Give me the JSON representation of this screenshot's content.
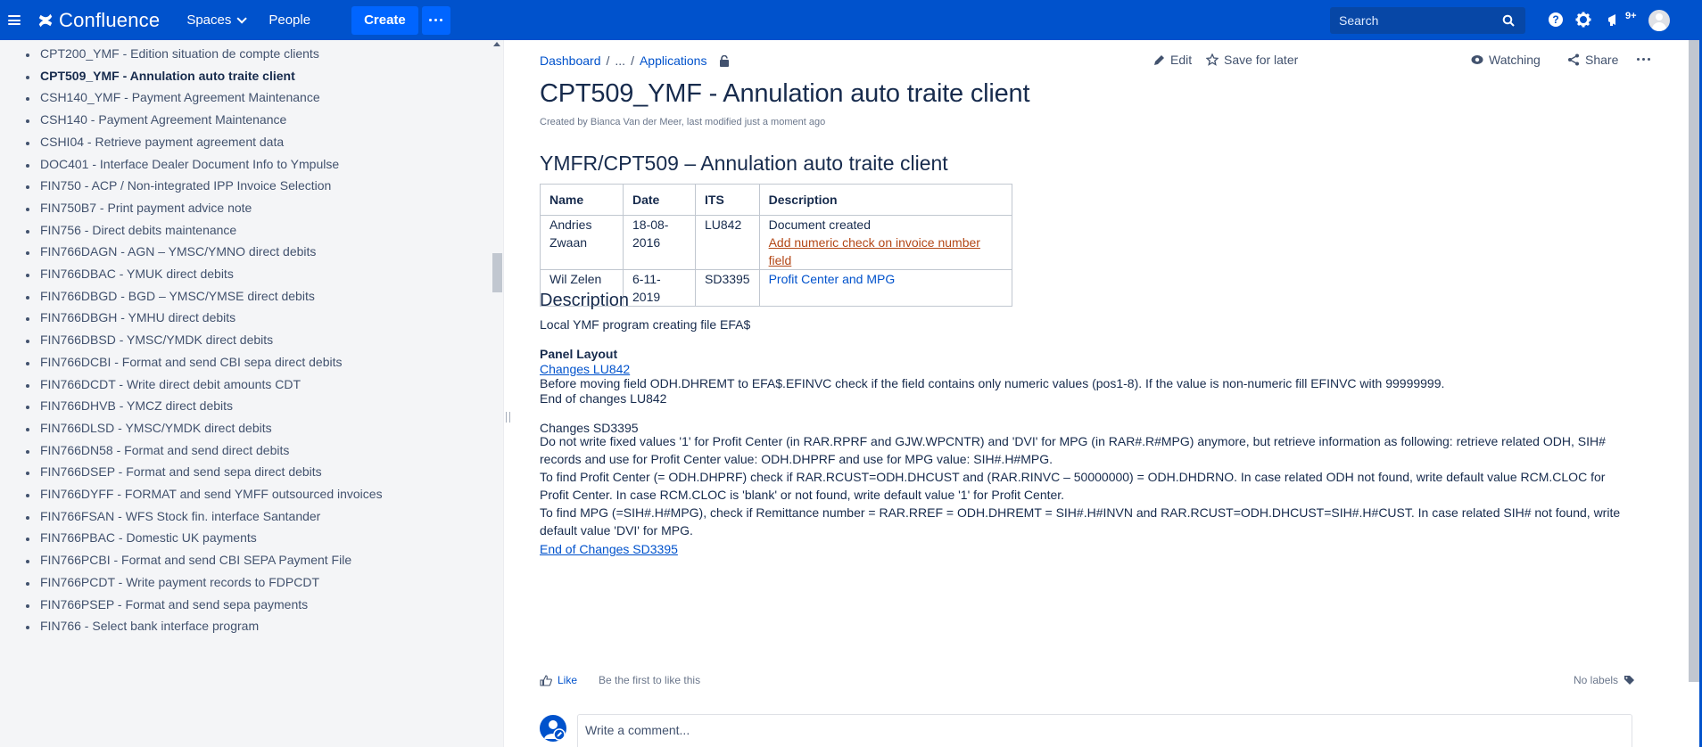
{
  "app": {
    "logo_text": "Confluence",
    "nav": {
      "spaces": "Spaces",
      "people": "People",
      "create": "Create"
    },
    "search_placeholder": "Search",
    "notifications_badge": "9+",
    "brand_color": "#0052cc"
  },
  "sidebar": {
    "items": [
      {
        "label": "CPT200_YMF - Edition situation de compte clients",
        "active": false
      },
      {
        "label": "CPT509_YMF - Annulation auto traite client",
        "active": true
      },
      {
        "label": "CSH140_YMF - Payment Agreement Maintenance",
        "active": false
      },
      {
        "label": "CSH140 - Payment Agreement Maintenance",
        "active": false
      },
      {
        "label": "CSHI04 - Retrieve payment agreement data",
        "active": false
      },
      {
        "label": "DOC401 - Interface Dealer Document Info to Ympulse",
        "active": false
      },
      {
        "label": "FIN750 - ACP / Non-integrated IPP Invoice Selection",
        "active": false
      },
      {
        "label": "FIN750B7 - Print payment advice note",
        "active": false
      },
      {
        "label": "FIN756 - Direct debits maintenance",
        "active": false
      },
      {
        "label": "FIN766DAGN - AGN – YMSC/YMNO direct debits",
        "active": false
      },
      {
        "label": "FIN766DBAC - YMUK direct debits",
        "active": false
      },
      {
        "label": "FIN766DBGD - BGD – YMSC/YMSE direct debits",
        "active": false
      },
      {
        "label": "FIN766DBGH - YMHU direct debits",
        "active": false
      },
      {
        "label": "FIN766DBSD - YMSC/YMDK direct debits",
        "active": false
      },
      {
        "label": "FIN766DCBI - Format and send CBI sepa direct debits",
        "active": false
      },
      {
        "label": "FIN766DCDT - Write direct debit amounts CDT",
        "active": false
      },
      {
        "label": "FIN766DHVB - YMCZ direct debits",
        "active": false
      },
      {
        "label": "FIN766DLSD - YMSC/YMDK direct debits",
        "active": false
      },
      {
        "label": "FIN766DN58 - Format and send direct debits",
        "active": false
      },
      {
        "label": "FIN766DSEP - Format and send sepa direct debits",
        "active": false
      },
      {
        "label": "FIN766DYFF - FORMAT and send YMFF outsourced invoices",
        "active": false
      },
      {
        "label": "FIN766FSAN - WFS Stock fin. interface Santander",
        "active": false
      },
      {
        "label": "FIN766PBAC - Domestic UK payments",
        "active": false
      },
      {
        "label": "FIN766PCBI - Format and send CBI SEPA Payment File",
        "active": false
      },
      {
        "label": "FIN766PCDT - Write payment records to FDPCDT",
        "active": false
      },
      {
        "label": "FIN766PSEP - Format and send sepa payments",
        "active": false
      },
      {
        "label": "FIN766 - Select bank interface program",
        "active": false
      }
    ]
  },
  "breadcrumb": {
    "dashboard": "Dashboard",
    "sep1": "/",
    "ellipsis": "...",
    "sep2": "/",
    "applications": "Applications"
  },
  "actions": {
    "edit": "Edit",
    "save": "Save for later",
    "watching": "Watching",
    "share": "Share"
  },
  "page": {
    "title": "CPT509_YMF - Annulation auto traite client",
    "byline": "Created by Bianca Van der Meer, last modified just a moment ago",
    "heading": "YMFR/CPT509 – Annulation auto traite client",
    "table": {
      "headers": [
        "Name",
        "Date",
        "ITS",
        "Description"
      ],
      "rows": [
        {
          "name": "Andries Zwaan",
          "date": "18-08-2016",
          "its": "LU842",
          "desc1": "Document created",
          "desc2": "Add numeric check on invoice number field"
        },
        {
          "name": "Wil Zelen",
          "date": "6-11-2019",
          "its": "SD3395",
          "desc1": "Profit Center and MPG"
        }
      ]
    },
    "description_heading": "Description",
    "description_text": "Local YMF program creating file EFA$",
    "panel_layout": "Panel Layout",
    "changes_lu842": "Changes LU842",
    "lu842_text": "Before moving field ODH.DHREMT to EFA$.EFINVC check if the field contains only numeric values (pos1-8). If the value is non-numeric fill EFINVC with 99999999.",
    "end_lu842": "End of changes LU842",
    "changes_sd3395": "Changes SD3395",
    "sd3395_p1": "Do not write fixed values '1' for Profit Center (in RAR.RPRF and GJW.WPCNTR) and 'DVI' for MPG (in RAR#.R#MPG) anymore, but retrieve information as following: retrieve related ODH, SIH# records and use for Profit Center value: ODH.DHPRF and use for MPG value: SIH#.H#MPG.",
    "sd3395_p2": "To find Profit Center (= ODH.DHPRF) check if RAR.RCUST=ODH.DHCUST and (RAR.RINVC – 50000000) = ODH.DHDRNO. In case related ODH not found, write default value RCM.CLOC for Profit Center. In case RCM.CLOC is 'blank' or not found, write default value '1' for Profit Center.",
    "sd3395_p3": "To find MPG (=SIH#.H#MPG), check if Remittance number = RAR.RREF = ODH.DHREMT = SIH#.H#INVN and RAR.RCUST=ODH.DHCUST=SIH#.H#CUST. In case related SIH# not found, write default value 'DVI' for MPG.",
    "end_sd3395": "End of Changes SD3395",
    "like": "Like",
    "like_hint": "Be the first to like this",
    "no_labels": "No labels",
    "comment_placeholder": "Write a comment..."
  }
}
